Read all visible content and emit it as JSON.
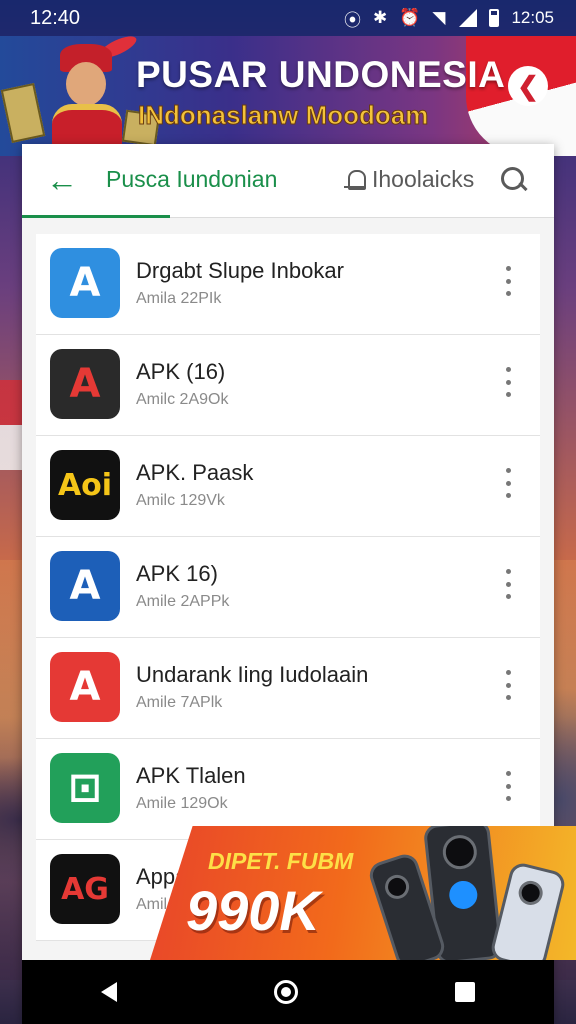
{
  "status_bar": {
    "time_left": "12:40",
    "time_right": "12:05",
    "icons": [
      "nfc-icon",
      "bluetooth-icon",
      "alarm-icon",
      "wifi-icon",
      "signal-icon",
      "battery-icon"
    ]
  },
  "banner": {
    "title": "PUSAR UNDONESIA",
    "subtitle": "INdonaslanw Moodoam"
  },
  "toolbar": {
    "active_tab": "Pusca Iundonian",
    "second_tab": "Ihoolaicks"
  },
  "apps": [
    {
      "name": "Drgabt Slupe Inbokar",
      "meta": "Amila 22PIk",
      "icon": "app-store-a-icon",
      "icon_text": "A",
      "bg": "#2f8fe0",
      "fg": "#ffffff"
    },
    {
      "name": "APK (16)",
      "meta": "Amilc 2A9Ok",
      "icon": "tricolor-a-icon",
      "icon_text": "A",
      "bg": "#2a2a2a",
      "fg": "#e53935"
    },
    {
      "name": "APK. Paask",
      "meta": "Amilc 129Vk",
      "icon": "aoi-logo-icon",
      "icon_text": "Aoi",
      "bg": "#111111",
      "fg": "#f5c518"
    },
    {
      "name": "APK 16)",
      "meta": "Amile 2APPk",
      "icon": "blue-a-icon",
      "icon_text": "A",
      "bg": "#1d5fb8",
      "fg": "#ffffff"
    },
    {
      "name": "Undarank Iing Iudolaain",
      "meta": "Amile 7APlk",
      "icon": "red-a-page-icon",
      "icon_text": "A",
      "bg": "#e53935",
      "fg": "#ffffff"
    },
    {
      "name": "APK Tlalen",
      "meta": "Amile 129Ok",
      "icon": "green-box-icon",
      "icon_text": "⊡",
      "bg": "#22a05a",
      "fg": "#ffffff"
    },
    {
      "name": "Appa",
      "meta": "Amile",
      "icon": "ag-logo-icon",
      "icon_text": "AG",
      "bg": "#111111",
      "fg": "#e53935"
    }
  ],
  "promo": {
    "caption": "DIPET. FUBM",
    "amount": "990K"
  },
  "colors": {
    "accent": "#1a8f4a",
    "banner_title": "#ffffff",
    "banner_subtitle": "#f3c23b",
    "promo_gradient_start": "#e8452a",
    "promo_gradient_end": "#f3b829"
  }
}
